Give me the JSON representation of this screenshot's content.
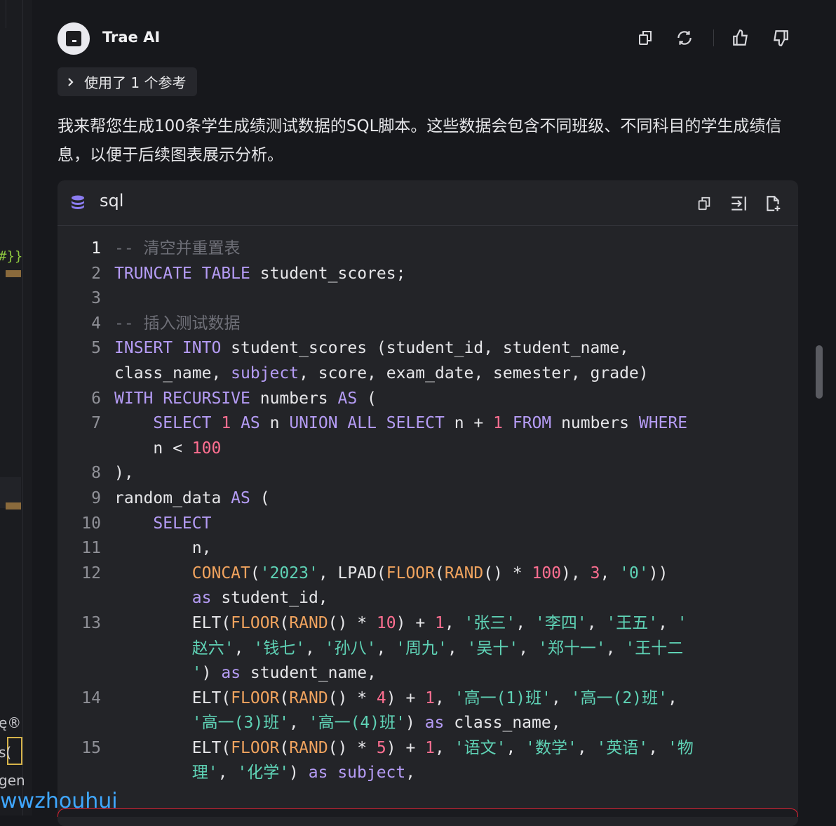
{
  "left_strip": {
    "code_fragment": "#}}",
    "text_fragment_1": "ę®",
    "text_fragment_2": "s(",
    "text_fragment_3": "gen"
  },
  "watermark": "wwzhouhui",
  "header": {
    "title": "Trae AI",
    "icons": [
      "copy-icon",
      "refresh-icon",
      "thumbs-up-icon",
      "thumbs-down-icon"
    ]
  },
  "reference": {
    "label": "使用了 1 个参考"
  },
  "message": {
    "text": "我来帮您生成100条学生成绩测试数据的SQL脚本。这些数据会包含不同班级、不同科目的学生成绩信息，以便于后续图表展示分析。"
  },
  "code_block": {
    "language": "sql",
    "icons": [
      "database-icon",
      "copy-code-icon",
      "insert-code-icon",
      "add-file-icon"
    ],
    "lines": [
      {
        "n": "1",
        "parts": [
          [
            "cm",
            "-- 清空并重置表"
          ]
        ]
      },
      {
        "n": "2",
        "parts": [
          [
            "kw",
            "TRUNCATE TABLE"
          ],
          [
            "pl",
            " student_scores;"
          ]
        ]
      },
      {
        "n": "3",
        "parts": []
      },
      {
        "n": "4",
        "parts": [
          [
            "cm",
            "-- 插入测试数据"
          ]
        ]
      },
      {
        "n": "5",
        "parts": [
          [
            "kw",
            "INSERT INTO"
          ],
          [
            "pl",
            " student_scores (student_id, student_name,"
          ]
        ]
      },
      {
        "n": "",
        "parts": [
          [
            "pl",
            "class_name, "
          ],
          [
            "kw",
            "subject"
          ],
          [
            "pl",
            ", score, exam_date, semester, grade)"
          ]
        ]
      },
      {
        "n": "6",
        "parts": [
          [
            "kw",
            "WITH RECURSIVE"
          ],
          [
            "pl",
            " numbers "
          ],
          [
            "kw",
            "AS"
          ],
          [
            "pl",
            " ("
          ]
        ]
      },
      {
        "n": "7",
        "parts": [
          [
            "pl",
            "    "
          ],
          [
            "kw",
            "SELECT"
          ],
          [
            "pl",
            " "
          ],
          [
            "num",
            "1"
          ],
          [
            "pl",
            " "
          ],
          [
            "kw",
            "AS"
          ],
          [
            "pl",
            " n "
          ],
          [
            "kw",
            "UNION ALL SELECT"
          ],
          [
            "pl",
            " n + "
          ],
          [
            "num",
            "1"
          ],
          [
            "pl",
            " "
          ],
          [
            "kw",
            "FROM"
          ],
          [
            "pl",
            " numbers "
          ],
          [
            "kw",
            "WHERE"
          ]
        ]
      },
      {
        "n": "",
        "parts": [
          [
            "pl",
            "    n < "
          ],
          [
            "num",
            "100"
          ]
        ]
      },
      {
        "n": "8",
        "parts": [
          [
            "pl",
            "),"
          ]
        ]
      },
      {
        "n": "9",
        "parts": [
          [
            "pl",
            "random_data "
          ],
          [
            "kw",
            "AS"
          ],
          [
            "pl",
            " ("
          ]
        ]
      },
      {
        "n": "10",
        "parts": [
          [
            "pl",
            "    "
          ],
          [
            "kw",
            "SELECT"
          ]
        ]
      },
      {
        "n": "11",
        "parts": [
          [
            "pl",
            "        n,"
          ]
        ]
      },
      {
        "n": "12",
        "parts": [
          [
            "pl",
            "        "
          ],
          [
            "fn",
            "CONCAT"
          ],
          [
            "pl",
            "("
          ],
          [
            "str",
            "'2023'"
          ],
          [
            "pl",
            ", LPAD("
          ],
          [
            "fn",
            "FLOOR"
          ],
          [
            "pl",
            "("
          ],
          [
            "fn",
            "RAND"
          ],
          [
            "pl",
            "() * "
          ],
          [
            "num",
            "100"
          ],
          [
            "pl",
            "), "
          ],
          [
            "num",
            "3"
          ],
          [
            "pl",
            ", "
          ],
          [
            "str",
            "'0'"
          ],
          [
            "pl",
            "))"
          ]
        ]
      },
      {
        "n": "",
        "parts": [
          [
            "pl",
            "        "
          ],
          [
            "kw",
            "as"
          ],
          [
            "pl",
            " student_id,"
          ]
        ]
      },
      {
        "n": "13",
        "parts": [
          [
            "pl",
            "        ELT("
          ],
          [
            "fn",
            "FLOOR"
          ],
          [
            "pl",
            "("
          ],
          [
            "fn",
            "RAND"
          ],
          [
            "pl",
            "() * "
          ],
          [
            "num",
            "10"
          ],
          [
            "pl",
            ") + "
          ],
          [
            "num",
            "1"
          ],
          [
            "pl",
            ", "
          ],
          [
            "str",
            "'张三'"
          ],
          [
            "pl",
            ", "
          ],
          [
            "str",
            "'李四'"
          ],
          [
            "pl",
            ", "
          ],
          [
            "str",
            "'王五'"
          ],
          [
            "pl",
            ", "
          ],
          [
            "str",
            "'"
          ]
        ]
      },
      {
        "n": "",
        "parts": [
          [
            "pl",
            "        "
          ],
          [
            "str",
            "赵六'"
          ],
          [
            "pl",
            ", "
          ],
          [
            "str",
            "'钱七'"
          ],
          [
            "pl",
            ", "
          ],
          [
            "str",
            "'孙八'"
          ],
          [
            "pl",
            ", "
          ],
          [
            "str",
            "'周九'"
          ],
          [
            "pl",
            ", "
          ],
          [
            "str",
            "'吴十'"
          ],
          [
            "pl",
            ", "
          ],
          [
            "str",
            "'郑十一'"
          ],
          [
            "pl",
            ", "
          ],
          [
            "str",
            "'王十二"
          ]
        ]
      },
      {
        "n": "",
        "parts": [
          [
            "pl",
            "        "
          ],
          [
            "str",
            "'"
          ],
          [
            "pl",
            ") "
          ],
          [
            "kw",
            "as"
          ],
          [
            "pl",
            " student_name,"
          ]
        ]
      },
      {
        "n": "14",
        "parts": [
          [
            "pl",
            "        ELT("
          ],
          [
            "fn",
            "FLOOR"
          ],
          [
            "pl",
            "("
          ],
          [
            "fn",
            "RAND"
          ],
          [
            "pl",
            "() * "
          ],
          [
            "num",
            "4"
          ],
          [
            "pl",
            ") + "
          ],
          [
            "num",
            "1"
          ],
          [
            "pl",
            ", "
          ],
          [
            "str",
            "'高一(1)班'"
          ],
          [
            "pl",
            ", "
          ],
          [
            "str",
            "'高一(2)班'"
          ],
          [
            "pl",
            ","
          ]
        ]
      },
      {
        "n": "",
        "parts": [
          [
            "pl",
            "        "
          ],
          [
            "str",
            "'高一(3)班'"
          ],
          [
            "pl",
            ", "
          ],
          [
            "str",
            "'高一(4)班'"
          ],
          [
            "pl",
            ") "
          ],
          [
            "kw",
            "as"
          ],
          [
            "pl",
            " class_name,"
          ]
        ]
      },
      {
        "n": "15",
        "parts": [
          [
            "pl",
            "        ELT("
          ],
          [
            "fn",
            "FLOOR"
          ],
          [
            "pl",
            "("
          ],
          [
            "fn",
            "RAND"
          ],
          [
            "pl",
            "() * "
          ],
          [
            "num",
            "5"
          ],
          [
            "pl",
            ") + "
          ],
          [
            "num",
            "1"
          ],
          [
            "pl",
            ", "
          ],
          [
            "str",
            "'语文'"
          ],
          [
            "pl",
            ", "
          ],
          [
            "str",
            "'数学'"
          ],
          [
            "pl",
            ", "
          ],
          [
            "str",
            "'英语'"
          ],
          [
            "pl",
            ", "
          ],
          [
            "str",
            "'物"
          ]
        ]
      },
      {
        "n": "",
        "parts": [
          [
            "pl",
            "        "
          ],
          [
            "str",
            "理'"
          ],
          [
            "pl",
            ", "
          ],
          [
            "str",
            "'化学'"
          ],
          [
            "pl",
            ") "
          ],
          [
            "kw",
            "as"
          ],
          [
            "pl",
            " "
          ],
          [
            "kw",
            "subject"
          ],
          [
            "pl",
            ","
          ]
        ]
      }
    ]
  },
  "colors": {
    "keyword": "#b59cf5",
    "function": "#f0a35e",
    "number": "#ff6f91",
    "string": "#5fd3b6",
    "comment": "#6e6f77"
  }
}
